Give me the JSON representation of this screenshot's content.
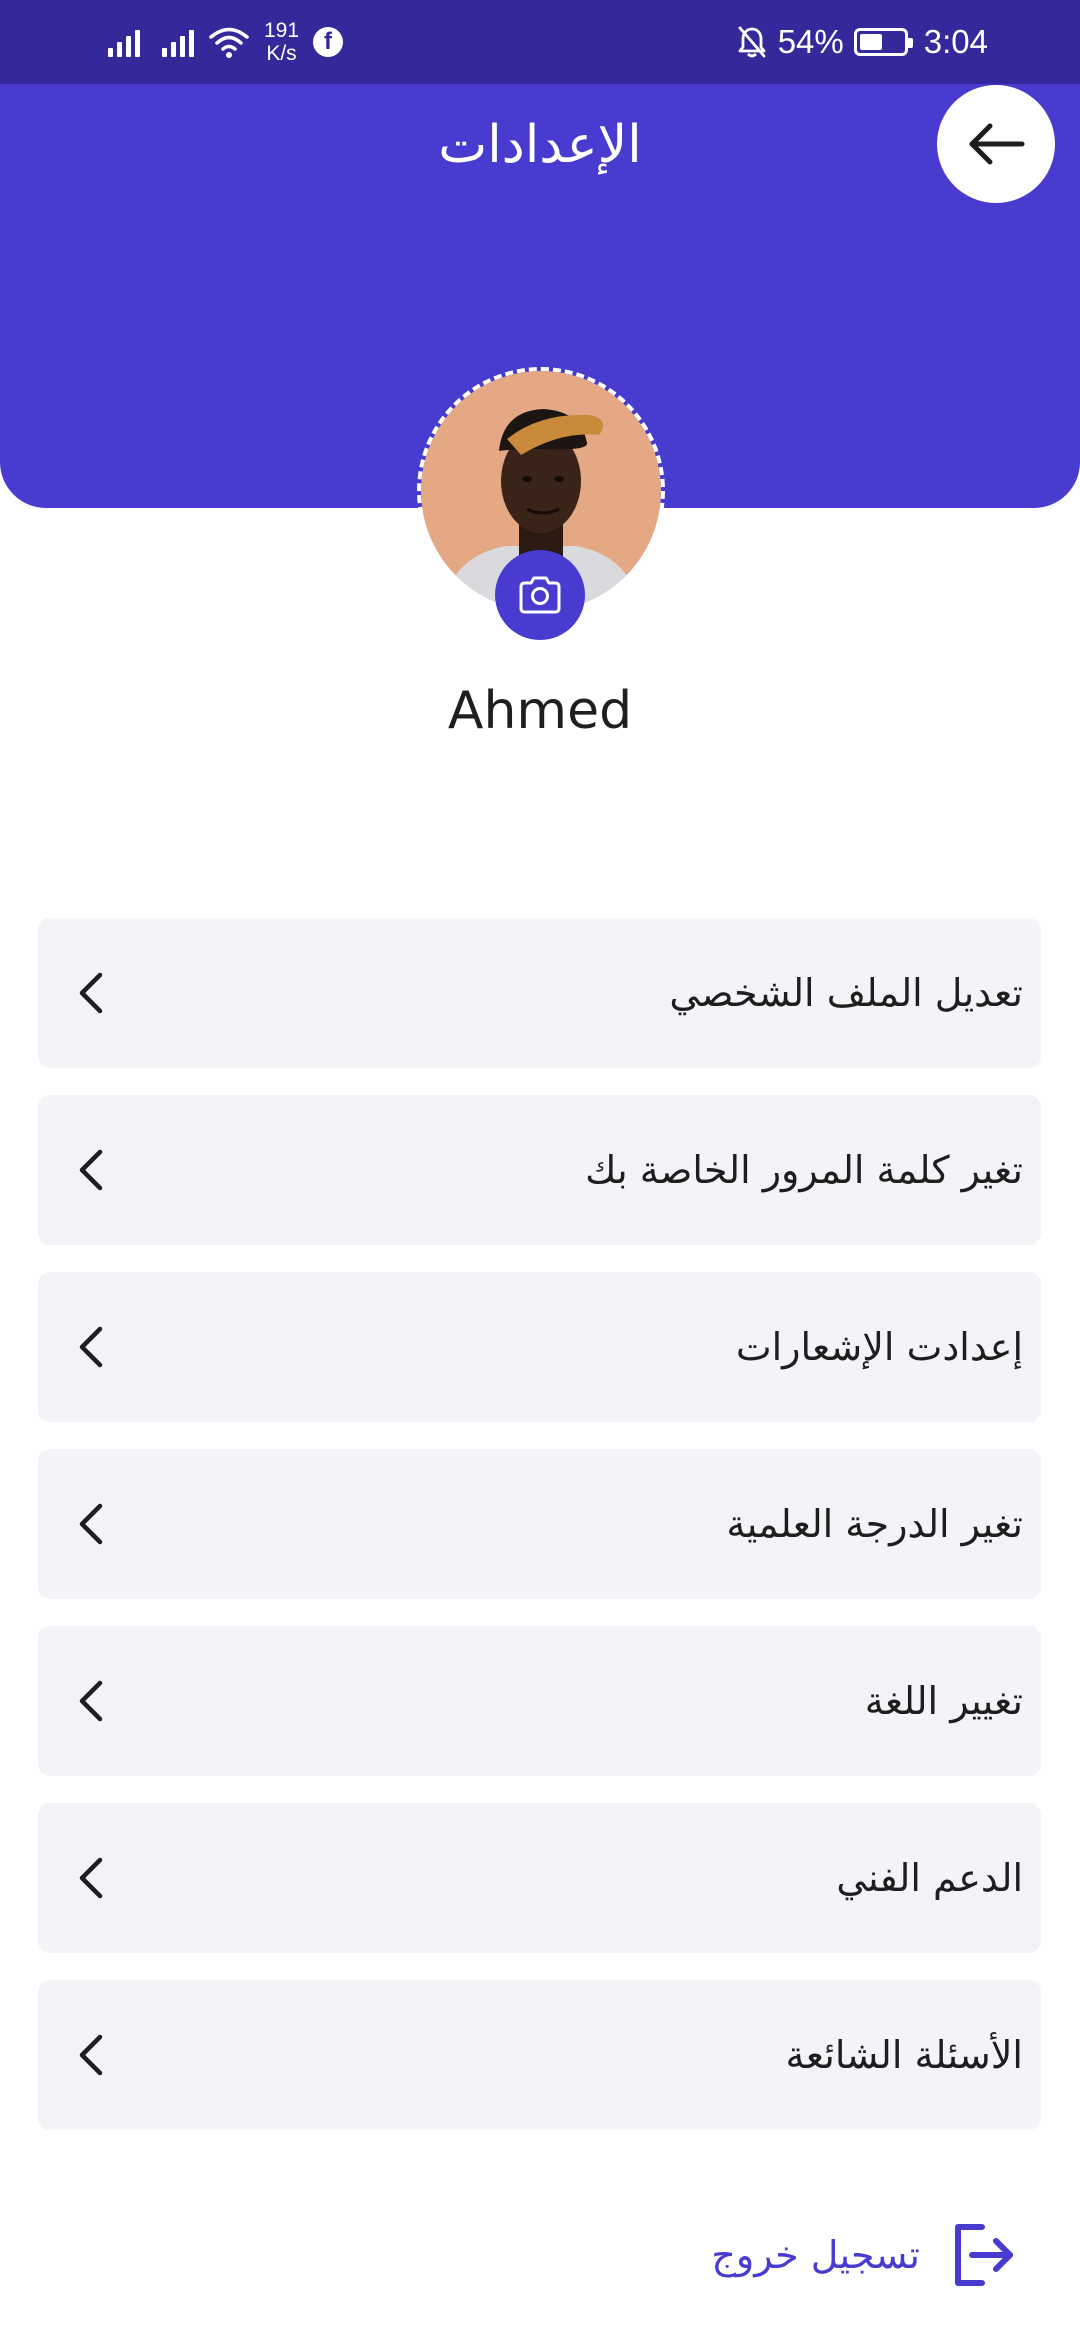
{
  "status_bar": {
    "net_speed_value": "191",
    "net_speed_unit": "K/s",
    "facebook_glyph": "f",
    "battery_percent": "54%",
    "battery_level": 0.54,
    "time": "3:04"
  },
  "header": {
    "title": "الإعدادات",
    "back_icon": "arrow-left-icon",
    "color": "#473bd0"
  },
  "profile": {
    "name": "Ahmed",
    "camera_icon": "camera-icon"
  },
  "menu": {
    "items": [
      {
        "label": "تعديل الملف الشخصي",
        "icon": "chevron-left-icon"
      },
      {
        "label": "تغير كلمة المرور الخاصة بك",
        "icon": "chevron-left-icon"
      },
      {
        "label": "إعدادت الإشعارات",
        "icon": "chevron-left-icon"
      },
      {
        "label": "تغير الدرجة العلمية",
        "icon": "chevron-left-icon"
      },
      {
        "label": "تغيير اللغة",
        "icon": "chevron-left-icon"
      },
      {
        "label": "الدعم الفني",
        "icon": "chevron-left-icon"
      },
      {
        "label": "الأسئلة الشائعة",
        "icon": "chevron-left-icon"
      }
    ]
  },
  "logout": {
    "label": "تسجيل خروج",
    "icon": "logout-icon"
  }
}
